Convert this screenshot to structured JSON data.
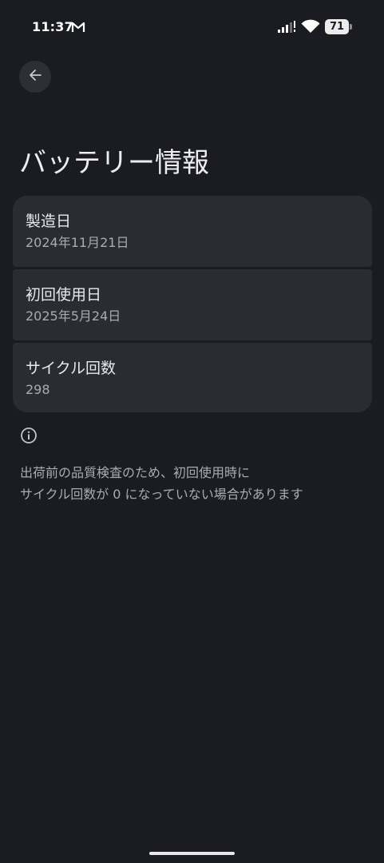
{
  "status_bar": {
    "time": "11:37",
    "battery_level": "71",
    "icons": [
      "gmail-icon",
      "signal-icon",
      "wifi-icon",
      "battery-icon"
    ]
  },
  "header": {
    "back_icon": "arrow-left-icon",
    "title": "バッテリー情報"
  },
  "battery_info": {
    "items": [
      {
        "label": "製造日",
        "value": "2024年11月21日"
      },
      {
        "label": "初回使用日",
        "value": "2025年5月24日"
      },
      {
        "label": "サイクル回数",
        "value": "298"
      }
    ]
  },
  "footer_note": {
    "icon": "info-icon",
    "lines": [
      "出荷前の品質検査のため、初回使用時に",
      "サイクル回数が 0 になっていない場合があります"
    ]
  },
  "colors": {
    "background": "#1b1c21",
    "card": "#2a2c34",
    "primary_text": "#e9e9ee",
    "secondary_text": "#a9abb3"
  }
}
